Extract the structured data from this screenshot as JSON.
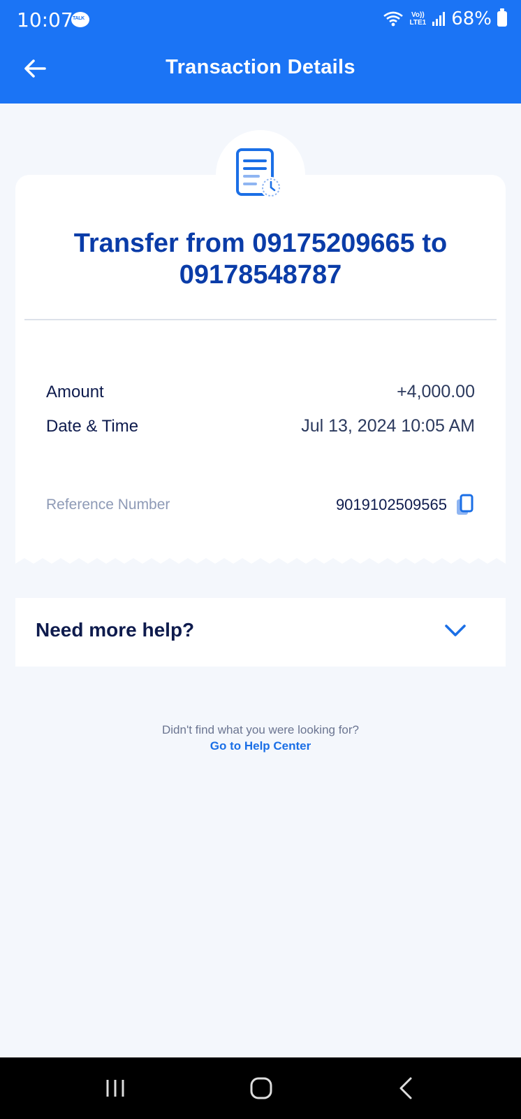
{
  "status_bar": {
    "time": "10:07",
    "talk_badge": "TALK",
    "volte_top": "Vo))",
    "volte_bottom": "LTE1",
    "battery": "68%",
    "icons": [
      "kakaotalk-icon",
      "wifi-icon",
      "volte-icon",
      "signal-icon",
      "battery-icon"
    ]
  },
  "header": {
    "title": "Transaction Details",
    "back_icon": "arrow-left-icon"
  },
  "receipt": {
    "icon": "document-clock-icon",
    "title": "Transfer from 09175209665 to 09178548787",
    "details": [
      {
        "label": "Amount",
        "value": "+4,000.00"
      },
      {
        "label": "Date & Time",
        "value": "Jul 13, 2024 10:05 AM"
      }
    ],
    "reference": {
      "label": "Reference Number",
      "value": "9019102509565",
      "icon": "copy-icon"
    }
  },
  "help": {
    "label": "Need more help?",
    "icon": "chevron-down-icon"
  },
  "footer": {
    "prompt": "Didn't find what you were looking for?",
    "link": "Go to Help Center"
  },
  "navbar": {
    "icons": [
      "recent-apps-icon",
      "home-icon",
      "back-icon"
    ]
  },
  "colors": {
    "header_bg": "#1b74f5",
    "title_blue": "#0a3ca8",
    "link_blue": "#1b6fe6",
    "page_bg": "#f4f7fc"
  }
}
